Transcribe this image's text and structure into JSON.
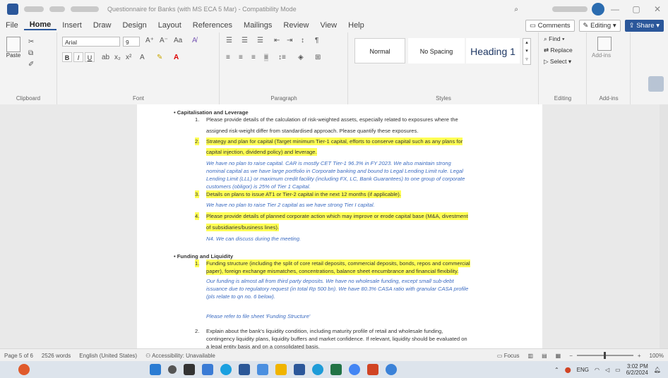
{
  "titlebar": {
    "doc_title": "Questionnaire for Banks (with MS ECA 5 Mar) - Compatibility Mode",
    "search_placeholder": "Search"
  },
  "menu": {
    "items": [
      "File",
      "Home",
      "Insert",
      "Draw",
      "Design",
      "Layout",
      "References",
      "Mailings",
      "Review",
      "View",
      "Help"
    ],
    "active": "Home",
    "comments": "Comments",
    "editing": "Editing",
    "share": "Share"
  },
  "ribbon": {
    "paste": "Paste",
    "clipboard_label": "Clipboard",
    "font_name": "Arial",
    "font_size": "9",
    "font_label": "Font",
    "paragraph_label": "Paragraph",
    "styles": [
      "Normal",
      "No Spacing",
      "Heading 1"
    ],
    "styles_label": "Styles",
    "find": "Find",
    "replace": "Replace",
    "select": "Select",
    "editing_label": "Editing",
    "addins": "Add-ins",
    "addins_label": "Add-ins"
  },
  "doc": {
    "sec1_title": "Capitalisation and Leverage",
    "q1": "Please provide details of the calculation of risk-weighted assets, especially related to exposures where the",
    "q1b": "assigned risk-weight differ from standardised approach. Please quantify these exposures.",
    "q2": "Strategy and plan for capital (Target minimum Tier-1 capital, efforts to conserve capital such as any plans for",
    "q2b": "capital injection, dividend policy) and leverage.",
    "a2a": "We have no plan to raise capital. CAR is mostly CET Tier-1 96.3% in FY 2023. We also maintain strong",
    "a2b": "nominal capital as we have large portfolio in Corporate banking and bound to Legal Lending Limit rule. Legal",
    "a2c": "Lending Limit (LLL) or maximum credit facility (including FX, LC, Bank Guarantees) to one group of corporate",
    "a2d": "customers (obligor) is 25% of Tier 1 Capital.",
    "q3": "Details on plans to issue AT1 or Tier-2 capital in the next 12 months (if applicable).",
    "a3": "We have no plan to raise Tier 2 capital as we have strong Tier I capital.",
    "q4": "Please provide details of planned corporate action which may improve or erode capital base (M&A, divestment",
    "q4b": "of subsidiaries/business lines).",
    "a4": "N4. We can discuss during the meeting.",
    "sec2_title": "Funding and Liquidity",
    "f1a": "Funding structure (including the split of core retail deposits, commercial deposits, bonds, repos and commercial",
    "f1b": "paper), foreign exchange mismatches, concentrations, balance sheet encumbrance and financial flexibility.",
    "fa1": "Our funding is almost all from third party deposits. We have no wholesale funding, except small sub-debt",
    "fa2": "issuance due to regulatory request (in total Rp 500 bn). We have 80.3% CASA ratio with granular CASA profile",
    "fa3": "(pls relate to qn no. 6 below).",
    "fa4": "Please refer to file sheet 'Funding Structure'",
    "f2a": "Explain about the bank's liquidity condition, including maturity profile of retail and wholesale funding,",
    "f2b": "contingency liquidity plans, liquidity buffers and market confidence. If relevant, liquidity should be evaluated on",
    "f2c": "a legal entity basis and on a consolidated basis.",
    "n1": "1.",
    "n2": "2.",
    "n3": "3.",
    "n4": "4."
  },
  "status": {
    "page": "Page 5 of 6",
    "words": "2526 words",
    "language": "English (United States)",
    "accessibility": "Accessibility: Unavailable",
    "focus": "Focus",
    "zoom": "100%"
  },
  "tray": {
    "lang": "ENG",
    "time": "3:02 PM",
    "date": "6/2/2024"
  },
  "colors": {
    "accent": "#2b579a",
    "highlight": "#ffff55",
    "answer_blue": "#3b6bc1"
  }
}
